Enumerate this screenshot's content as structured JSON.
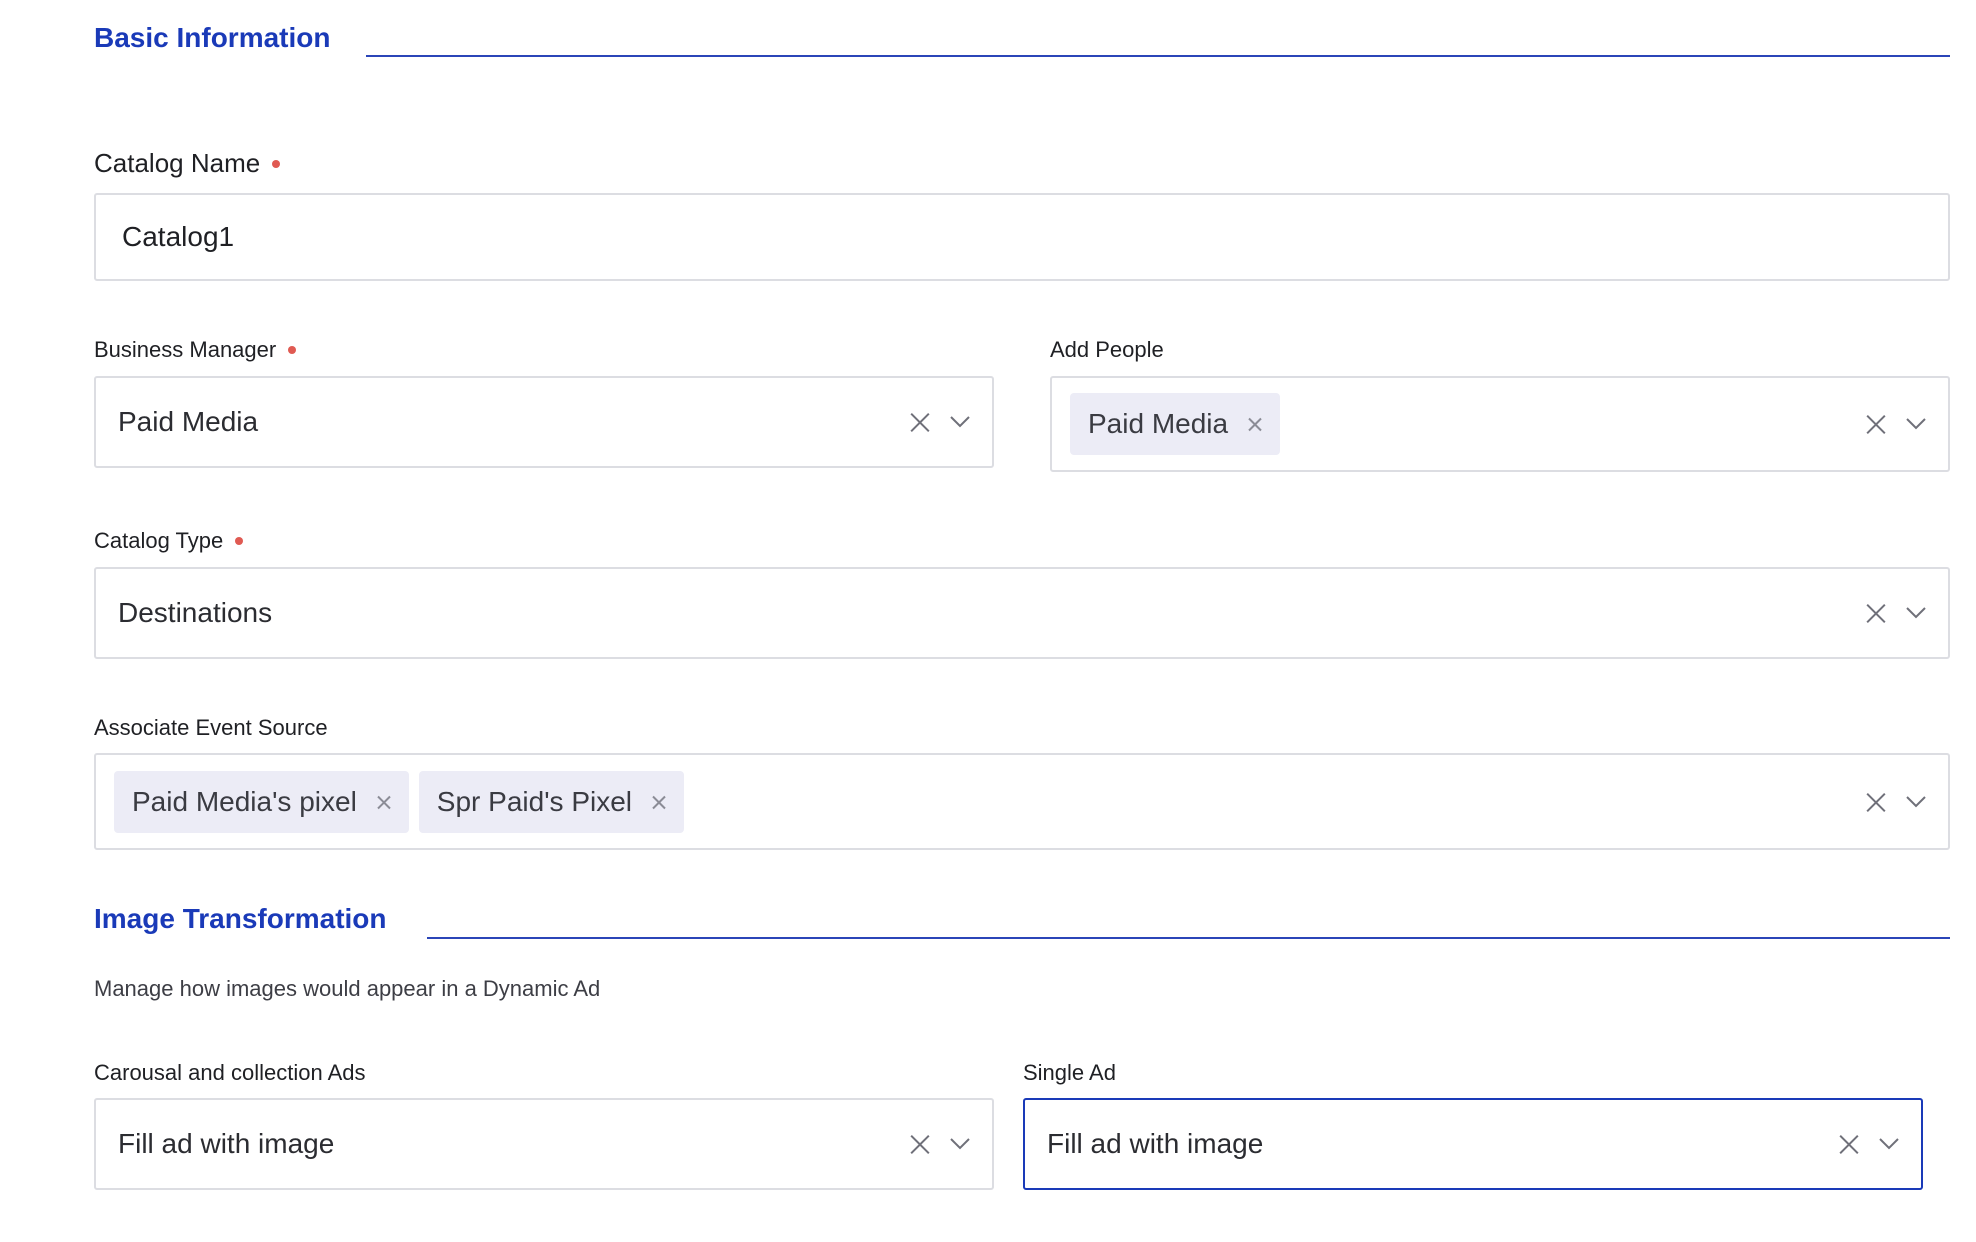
{
  "basic_section": {
    "title": "Basic Information"
  },
  "catalog_name": {
    "label": "Catalog Name",
    "value": "Catalog1"
  },
  "business_manager": {
    "label": "Business Manager",
    "value": "Paid Media"
  },
  "add_people": {
    "label": "Add People",
    "chips": [
      "Paid Media"
    ]
  },
  "catalog_type": {
    "label": "Catalog Type",
    "value": "Destinations"
  },
  "event_source": {
    "label": "Associate Event Source",
    "chips": [
      "Paid Media's pixel",
      "Spr Paid's Pixel"
    ]
  },
  "image_section": {
    "title": "Image Transformation",
    "description": "Manage how images would appear in a Dynamic Ad"
  },
  "carousel_ads": {
    "label": "Carousal and collection Ads",
    "value": "Fill ad with image"
  },
  "single_ad": {
    "label": "Single Ad",
    "value": "Fill ad with image"
  },
  "colors": {
    "accent": "#1a3ab8",
    "required_dot": "#e05a52",
    "chip_bg": "#ececf6",
    "border": "#dcdde2"
  },
  "icons": {
    "clear": "close-icon",
    "dropdown": "chevron-down-icon",
    "chip_remove": "close-icon"
  }
}
